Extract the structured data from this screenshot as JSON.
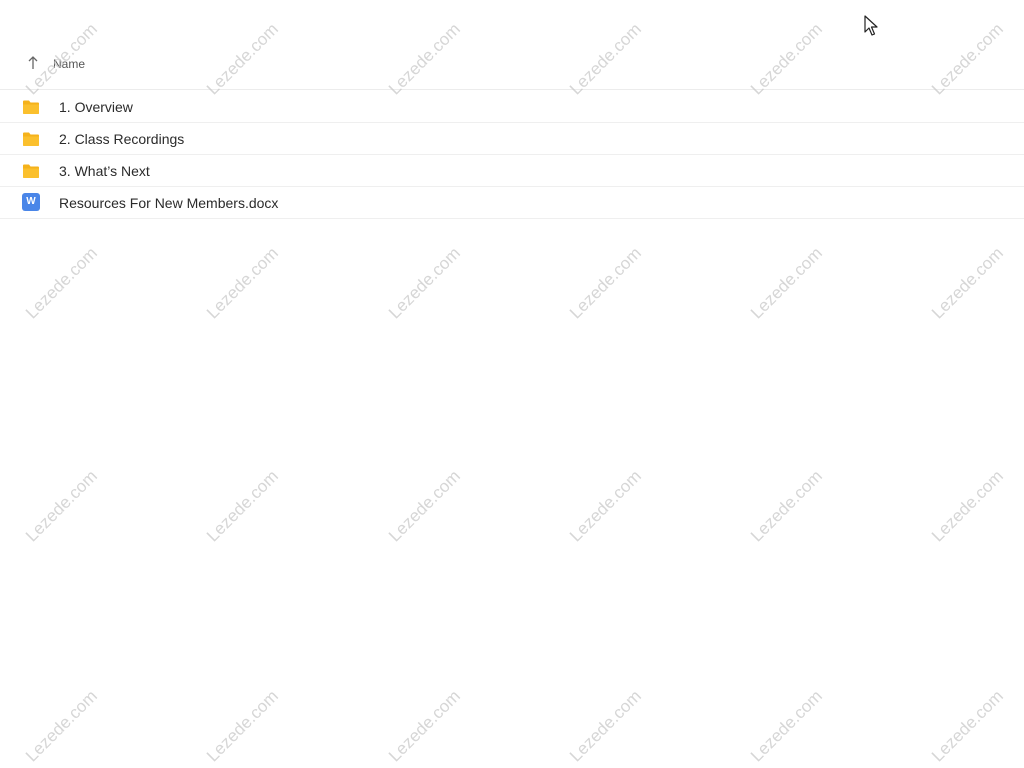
{
  "header": {
    "sort_column_label": "Name",
    "sort_icon": "arrow-up-icon"
  },
  "files": [
    {
      "name": "1. Overview",
      "type": "folder",
      "icon": "folder-icon"
    },
    {
      "name": "2. Class Recordings",
      "type": "folder",
      "icon": "folder-icon"
    },
    {
      "name": "3. What’s Next",
      "type": "folder",
      "icon": "folder-icon"
    },
    {
      "name": "Resources For New Members.docx",
      "type": "docx",
      "icon": "word-document-icon",
      "badge": "W"
    }
  ],
  "watermark": {
    "text": "Lezede.com"
  },
  "colors": {
    "folder": "#f5b21b",
    "word": "#4a86e8"
  }
}
